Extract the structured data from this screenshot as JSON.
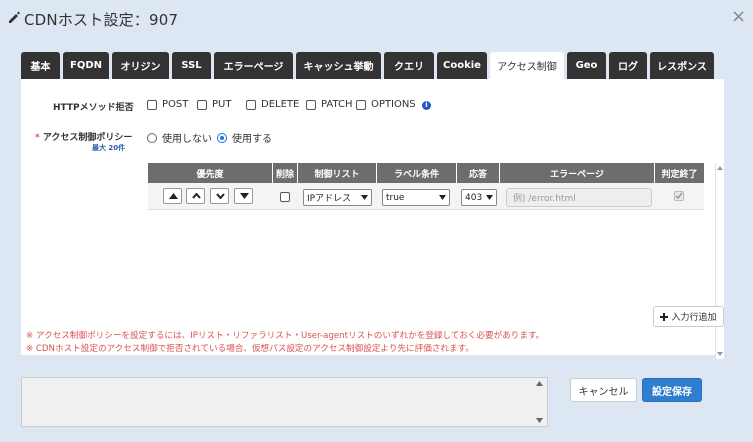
{
  "window": {
    "title": "CDNホスト設定：907",
    "close_label": "×"
  },
  "tabs": [
    {
      "label": "基本",
      "active": false
    },
    {
      "label": "FQDN",
      "active": false
    },
    {
      "label": "オリジン",
      "active": false
    },
    {
      "label": "SSL",
      "active": false
    },
    {
      "label": "エラーページ",
      "active": false
    },
    {
      "label": "キャッシュ挙動",
      "active": false
    },
    {
      "label": "クエリ",
      "active": false
    },
    {
      "label": "Cookie",
      "active": false
    },
    {
      "label": "アクセス制御",
      "active": true
    },
    {
      "label": "Geo",
      "active": false
    },
    {
      "label": "ログ",
      "active": false
    },
    {
      "label": "レスポンス",
      "active": false
    }
  ],
  "http_methods": {
    "label": "HTTPメソッド拒否",
    "options": [
      {
        "label": "POST",
        "checked": false
      },
      {
        "label": "PUT",
        "checked": false
      },
      {
        "label": "DELETE",
        "checked": false
      },
      {
        "label": "PATCH",
        "checked": false
      },
      {
        "label": "OPTIONS",
        "checked": false
      }
    ],
    "info_icon": "i"
  },
  "access_policy": {
    "required_mark": "*",
    "label": "アクセス制御ポリシー",
    "sub_label": "最大 20件",
    "options": [
      {
        "label": "使用しない",
        "selected": false
      },
      {
        "label": "使用する",
        "selected": true
      }
    ]
  },
  "table": {
    "headers": [
      "優先度",
      "削除",
      "制御リスト",
      "ラベル条件",
      "応答",
      "エラーページ",
      "判定終了"
    ],
    "rows": [
      {
        "delete_checked": false,
        "control_list": "IPアドレス",
        "label_condition": "true",
        "response": "403",
        "error_page_placeholder": "例) /error.html",
        "final_checked": true
      }
    ]
  },
  "add_row_button": "入力行追加",
  "notes": [
    "※ アクセス制御ポリシーを設定するには、IPリスト・リファラリスト・User-agentリストのいずれかを登録しておく必要があります。",
    "※ CDNホスト設定のアクセス制御で拒否されている場合、仮想パス設定のアクセス制御設定より先に評価されます。"
  ],
  "buttons": {
    "cancel": "キャンセル",
    "save": "設定保存"
  },
  "colors": {
    "tab_bg": "#333333",
    "header_bg": "#6d6d6d",
    "save_bg": "#2f7fd0",
    "note_red": "#d9534f",
    "page_bg": "#dde6f3"
  }
}
